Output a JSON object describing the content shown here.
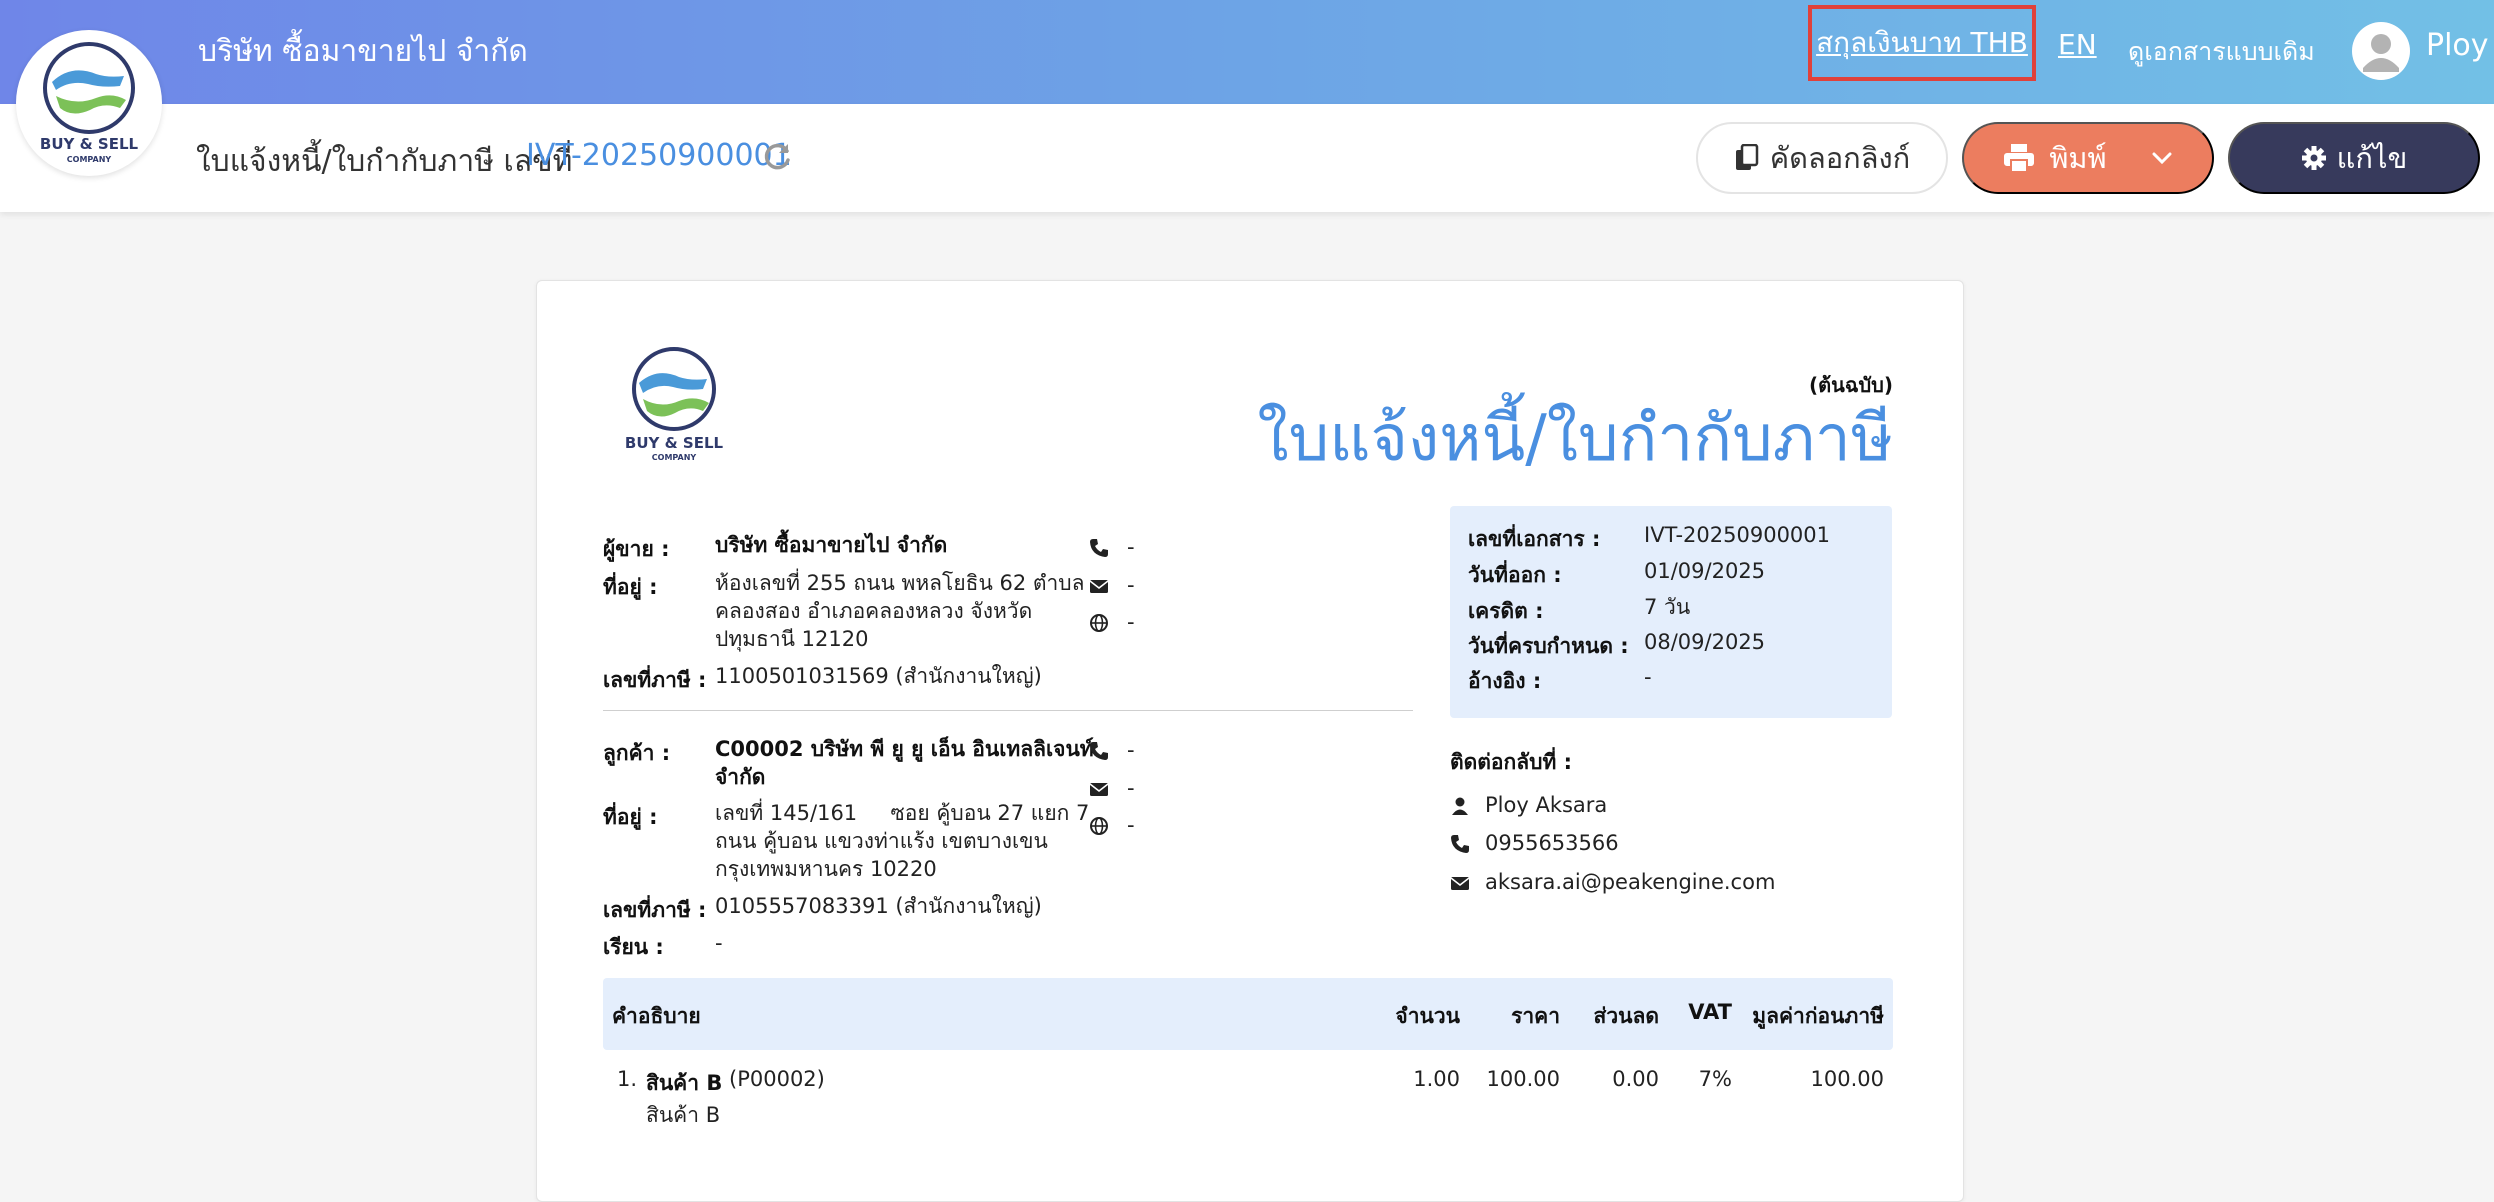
{
  "header": {
    "company_name": "บริษัท ซื้อมาขายไป จำกัด",
    "currency_link": "สกุลเงินบาท THB",
    "language_link": "EN",
    "legacy_view_link": "ดูเอกสารแบบเดิม",
    "user_name": "Ploy"
  },
  "logo": {
    "line1": "BUY & SELL",
    "line2": "COMPANY"
  },
  "toolbar": {
    "doc_type_label": "ใบแจ้งหนี้/ใบกำกับภาษี เลขที่",
    "doc_number": "IVT-20250900001",
    "copy_link_label": "คัดลอกลิงก์",
    "print_label": "พิมพ์",
    "edit_label": "แก้ไข"
  },
  "document": {
    "copy_type": "(ต้นฉบับ)",
    "title": "ใบแจ้งหนี้/ใบกำกับภาษี",
    "seller": {
      "label": "ผู้ขาย :",
      "name": "บริษัท ซื้อมาขายไป จำกัด",
      "address_label": "ที่อยู่ :",
      "address_lines": [
        "ห้องเลขที่ 255 ถนน พหลโยธิน 62 ตำบล",
        "คลองสอง อำเภอคลองหลวง จังหวัด",
        "ปทุมธานี 12120"
      ],
      "tax_label": "เลขที่ภาษี :",
      "tax_id": "1100501031569 (สำนักงานใหญ่)",
      "phone": "-",
      "email": "-",
      "website": "-"
    },
    "customer": {
      "label": "ลูกค้า :",
      "name_lines": [
        "C00002 บริษัท พี ยู ยู เอ็น อินเทลลิเจนท์",
        "จำกัด"
      ],
      "address_label": "ที่อยู่ :",
      "address_lines": [
        "เลขที่ 145/161     ซอย คู้บอน 27 แยก 7",
        "ถนน คู้บอน  แขวงท่าแร้ง เขตบางเขน",
        "กรุงเทพมหานคร 10220"
      ],
      "tax_label": "เลขที่ภาษี :",
      "tax_id": "0105557083391 (สำนักงานใหญ่)",
      "attn_label": "เรียน :",
      "attn": "-",
      "phone": "-",
      "email": "-",
      "website": "-"
    },
    "info": {
      "doc_no_label": "เลขที่เอกสาร :",
      "doc_no": "IVT-20250900001",
      "issue_date_label": "วันที่ออก :",
      "issue_date": "01/09/2025",
      "credit_label": "เครดิต :",
      "credit": "7 วัน",
      "due_date_label": "วันที่ครบกำหนด :",
      "due_date": "08/09/2025",
      "ref_label": "อ้างอิง :",
      "ref": "-"
    },
    "contact": {
      "label": "ติดต่อกลับที่ :",
      "name": "Ploy Aksara",
      "phone": "0955653566",
      "email": "aksara.ai@peakengine.com"
    },
    "table": {
      "headers": {
        "description": "คำอธิบาย",
        "qty": "จำนวน",
        "price": "ราคา",
        "discount": "ส่วนลด",
        "vat": "VAT",
        "pre_tax": "มูลค่าก่อนภาษี"
      },
      "rows": [
        {
          "index": "1.",
          "name": "สินค้า B",
          "code": "(P00002)",
          "sub": "สินค้า B",
          "qty": "1.00",
          "price": "100.00",
          "discount": "0.00",
          "vat": "7%",
          "pre_tax": "100.00"
        }
      ]
    }
  }
}
